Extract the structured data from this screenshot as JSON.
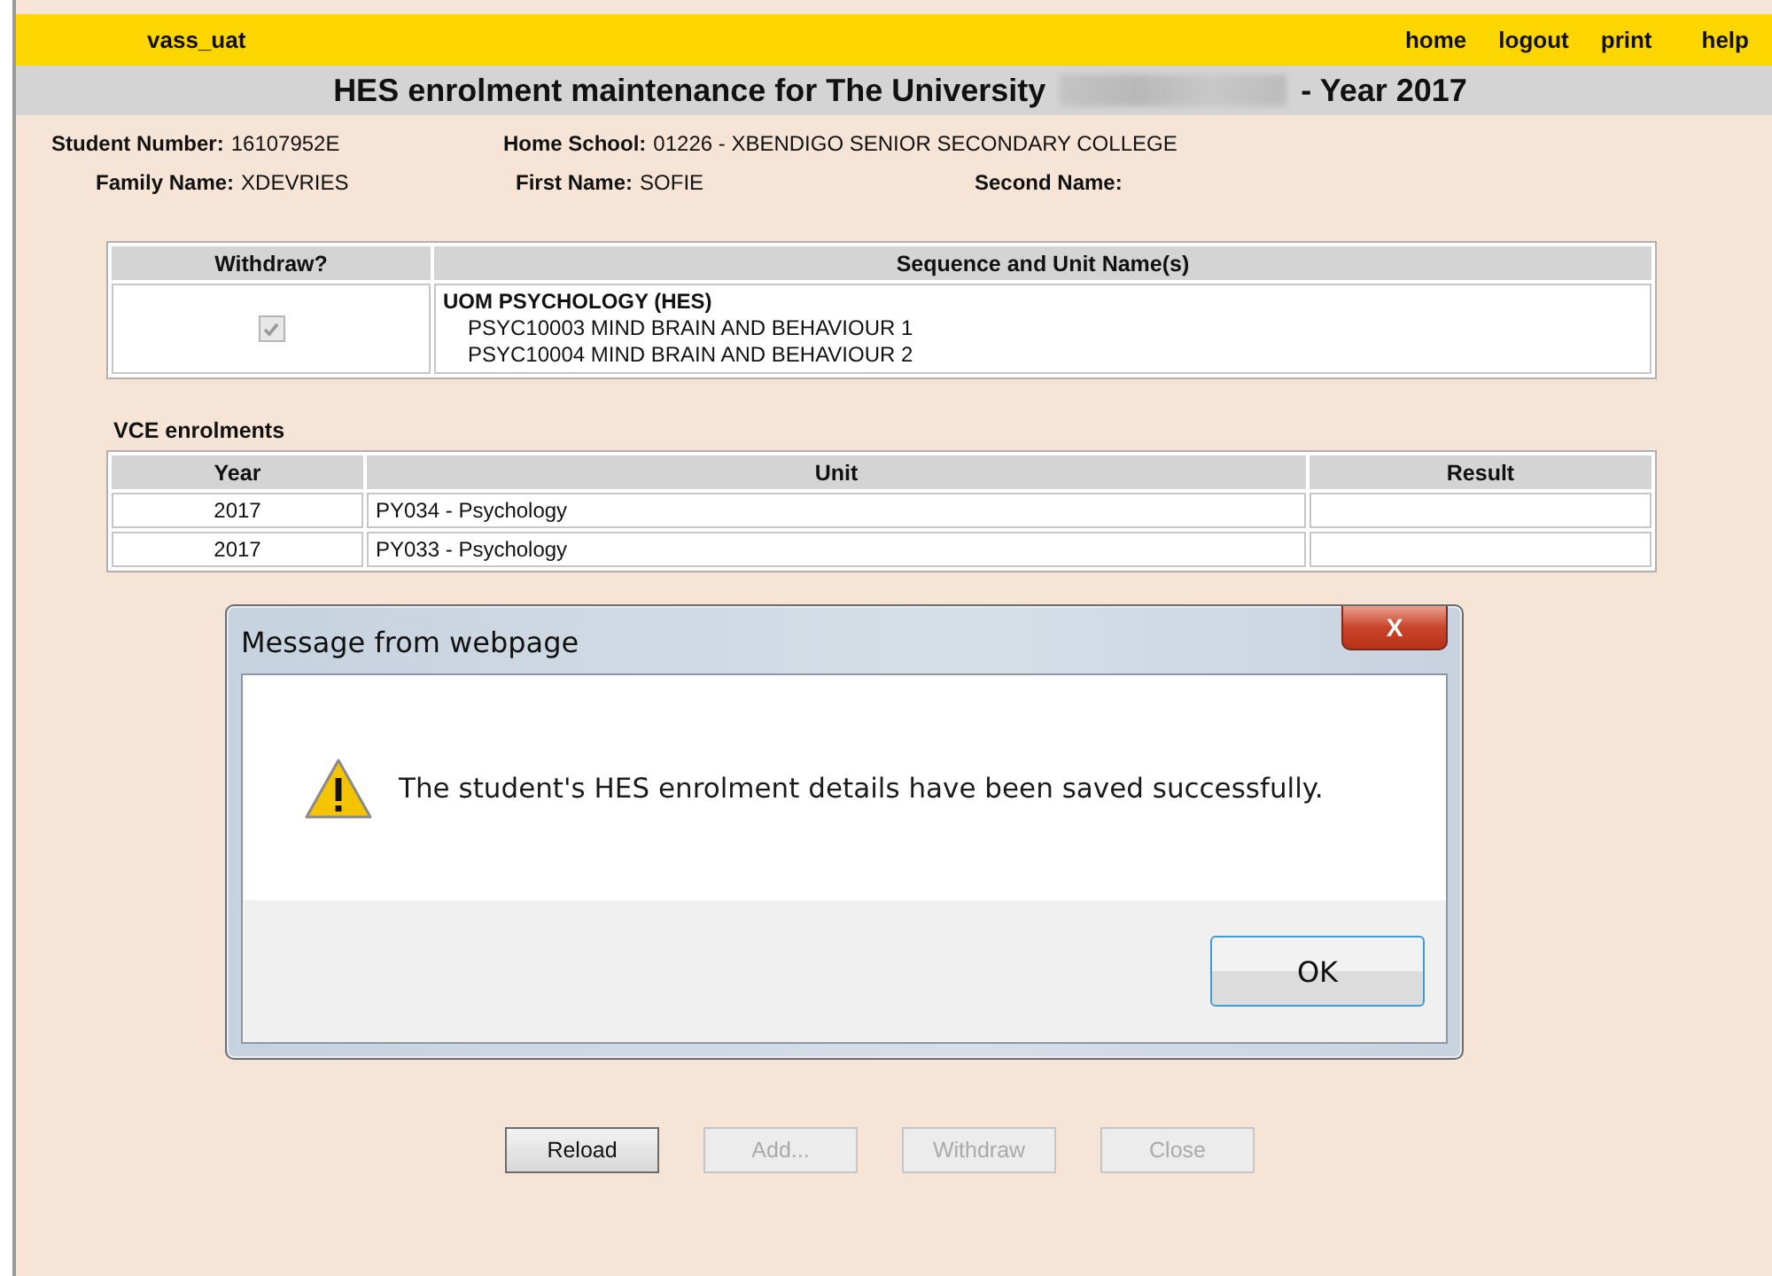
{
  "top_bar": {
    "app": "vass_uat",
    "links": [
      "home",
      "logout",
      "print",
      "help"
    ]
  },
  "title": {
    "before": "HES enrolment maintenance for The University",
    "redacted": true,
    "after": "- Year 2017"
  },
  "student_fields": [
    [
      {
        "label": "Student Number:",
        "value": "16107952E"
      },
      {
        "label": "Home School:",
        "value": "01226 - XBENDIGO SENIOR SECONDARY COLLEGE"
      }
    ],
    [
      {
        "label": "Family Name:",
        "value": "XDEVRIES"
      },
      {
        "label": "First Name:",
        "value": "SOFIE"
      },
      {
        "label": "Second Name:"
      }
    ]
  ],
  "hes_table": {
    "columns": [
      "Withdraw?",
      "Sequence and Unit Name(s)"
    ],
    "rows": [
      {
        "withdraw_checked": true,
        "withdraw_disabled": true,
        "sequence": "UOM PSYCHOLOGY (HES)",
        "units": [
          "PSYC10003 MIND BRAIN AND BEHAVIOUR 1",
          "PSYC10004 MIND BRAIN AND BEHAVIOUR 2"
        ]
      }
    ]
  },
  "vce": {
    "heading": "VCE enrolments",
    "columns": [
      "Year",
      "Unit",
      "Result"
    ],
    "rows": [
      {
        "year": "2017",
        "unit": "PY034 - Psychology"
      },
      {
        "year": "2017",
        "unit": "PY033 - Psychology"
      }
    ]
  },
  "buttons": [
    {
      "label": "Reload",
      "disabled": false
    },
    {
      "label": "Add...",
      "disabled": true
    },
    {
      "label": "Withdraw",
      "disabled": true
    },
    {
      "label": "Close",
      "disabled": true
    }
  ],
  "dialog": {
    "title": "Message from webpage",
    "close": "X",
    "message": "The student's HES enrolment details have been saved successfully.",
    "ok": "OK"
  }
}
